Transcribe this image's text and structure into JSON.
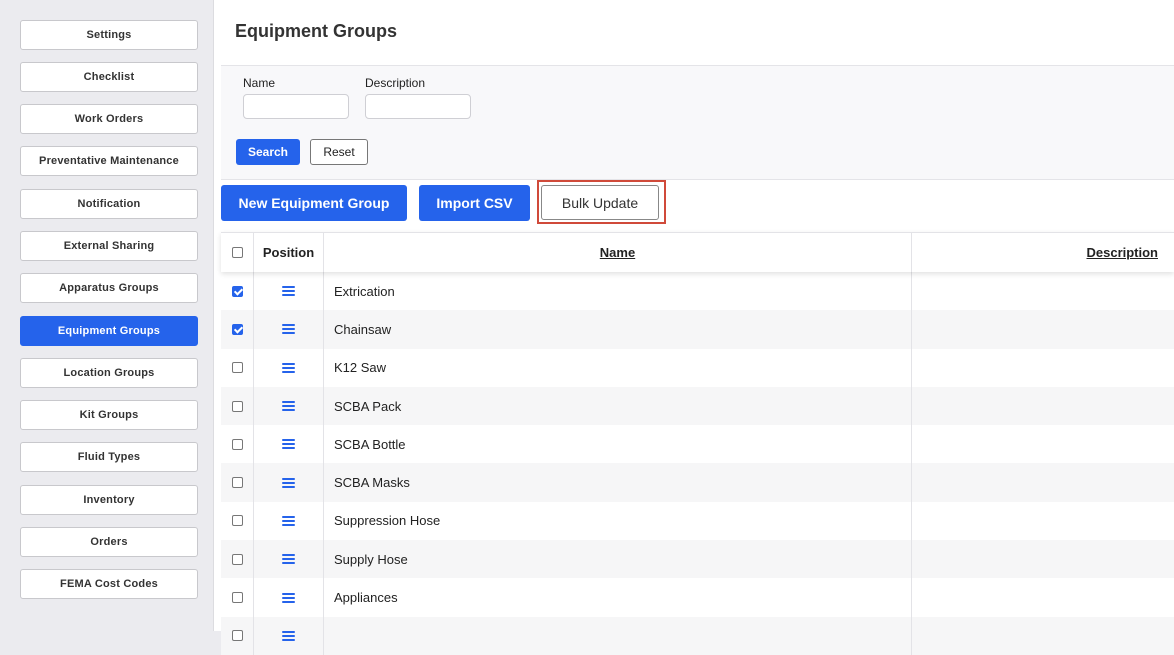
{
  "sidebar": {
    "items": [
      {
        "label": "Settings",
        "active": false
      },
      {
        "label": "Checklist",
        "active": false
      },
      {
        "label": "Work Orders",
        "active": false
      },
      {
        "label": "Preventative Maintenance",
        "active": false
      },
      {
        "label": "Notification",
        "active": false
      },
      {
        "label": "External Sharing",
        "active": false
      },
      {
        "label": "Apparatus Groups",
        "active": false
      },
      {
        "label": "Equipment Groups",
        "active": true
      },
      {
        "label": "Location Groups",
        "active": false
      },
      {
        "label": "Kit Groups",
        "active": false
      },
      {
        "label": "Fluid Types",
        "active": false
      },
      {
        "label": "Inventory",
        "active": false
      },
      {
        "label": "Orders",
        "active": false
      },
      {
        "label": "FEMA Cost Codes",
        "active": false
      }
    ]
  },
  "page": {
    "title": "Equipment Groups"
  },
  "filters": {
    "name_label": "Name",
    "name_value": "",
    "description_label": "Description",
    "description_value": "",
    "search_label": "Search",
    "reset_label": "Reset"
  },
  "actions": {
    "new_label": "New Equipment Group",
    "import_label": "Import CSV",
    "bulk_label": "Bulk Update"
  },
  "table": {
    "headers": {
      "position": "Position",
      "name": "Name",
      "description": "Description"
    },
    "header_checked": false,
    "rows": [
      {
        "checked": true,
        "name": "Extrication",
        "description": ""
      },
      {
        "checked": true,
        "name": "Chainsaw",
        "description": ""
      },
      {
        "checked": false,
        "name": "K12 Saw",
        "description": ""
      },
      {
        "checked": false,
        "name": "SCBA Pack",
        "description": ""
      },
      {
        "checked": false,
        "name": "SCBA Bottle",
        "description": ""
      },
      {
        "checked": false,
        "name": "SCBA Masks",
        "description": ""
      },
      {
        "checked": false,
        "name": "Suppression Hose",
        "description": ""
      },
      {
        "checked": false,
        "name": "Supply Hose",
        "description": ""
      },
      {
        "checked": false,
        "name": "Appliances",
        "description": ""
      },
      {
        "checked": false,
        "name": "",
        "description": ""
      }
    ]
  },
  "colors": {
    "accent": "#2563eb",
    "highlight": "#d04a3a"
  },
  "icons": {
    "drag_handle": "drag-handle-icon",
    "checkbox": "checkbox-icon"
  }
}
